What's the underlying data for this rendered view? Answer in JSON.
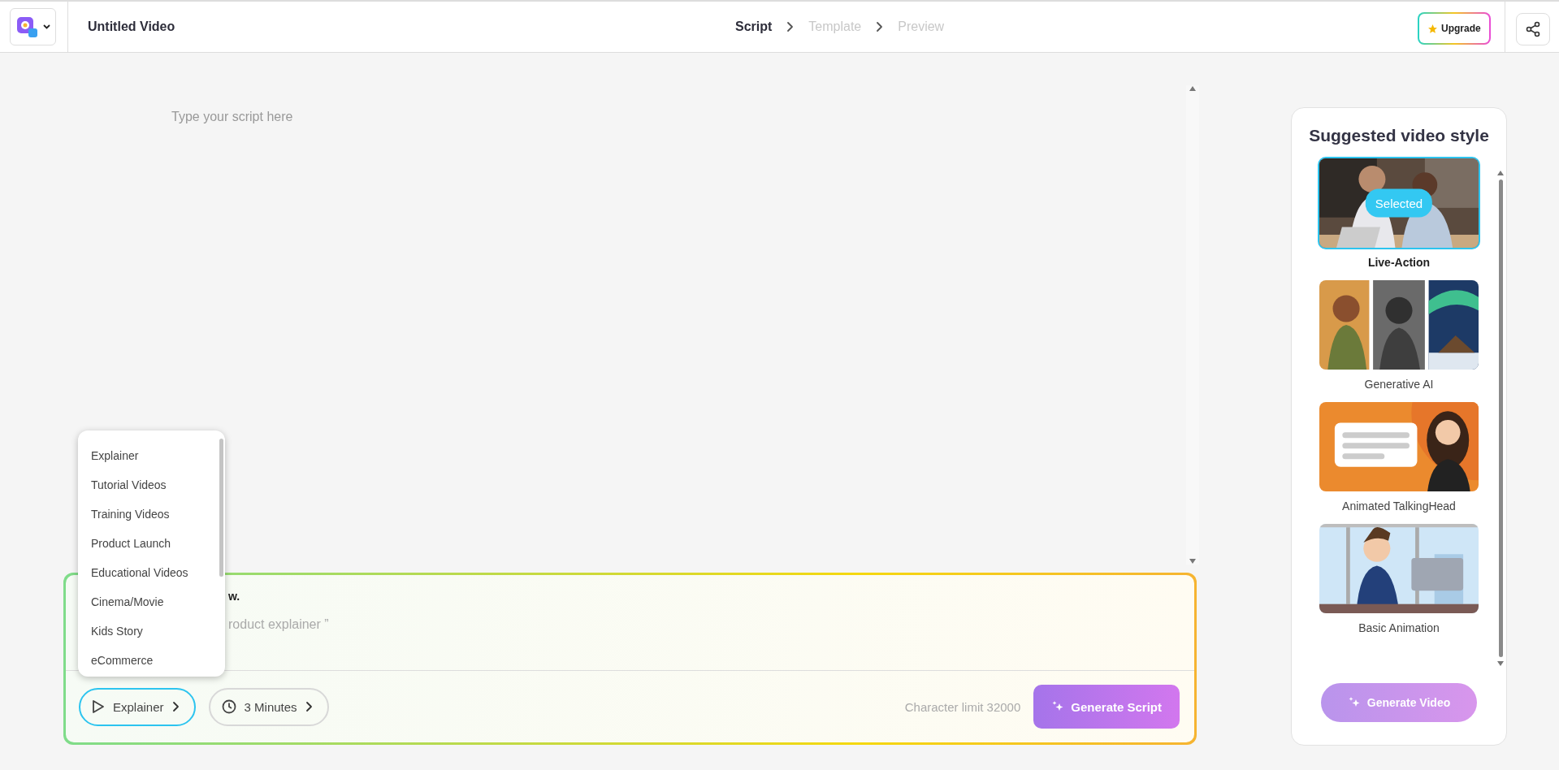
{
  "header": {
    "title": "Untitled Video",
    "upgrade": "Upgrade",
    "steps": [
      {
        "label": "Script",
        "selected": true
      },
      {
        "label": "Template",
        "selected": false
      },
      {
        "label": "Preview",
        "selected": false
      }
    ]
  },
  "editor": {
    "placeholder": "Type your script here"
  },
  "prompt": {
    "heading": "w.",
    "placeholder": "roduct explainer ”",
    "character_limit": "Character limit 32000",
    "generate_button": "Generate Script",
    "type_button": {
      "label": "Explainer",
      "expanded": true
    },
    "duration_button": {
      "label": "3 Minutes",
      "expanded": false
    }
  },
  "type_menu": {
    "items": [
      "Explainer",
      "Tutorial Videos",
      "Training Videos",
      "Product Launch",
      "Educational Videos",
      "Cinema/Movie",
      "Kids Story",
      "eCommerce"
    ]
  },
  "style_panel": {
    "title": "Suggested video style",
    "styles": [
      {
        "label": "Live-Action",
        "selected": true,
        "badge": "Selected",
        "kind": "live"
      },
      {
        "label": "Generative AI",
        "selected": false,
        "kind": "generative"
      },
      {
        "label": "Animated TalkingHead",
        "selected": false,
        "kind": "talking"
      },
      {
        "label": "Basic Animation",
        "selected": false,
        "kind": "basic"
      }
    ],
    "generate_button": {
      "label": "Generate Video",
      "disabled": true
    }
  }
}
